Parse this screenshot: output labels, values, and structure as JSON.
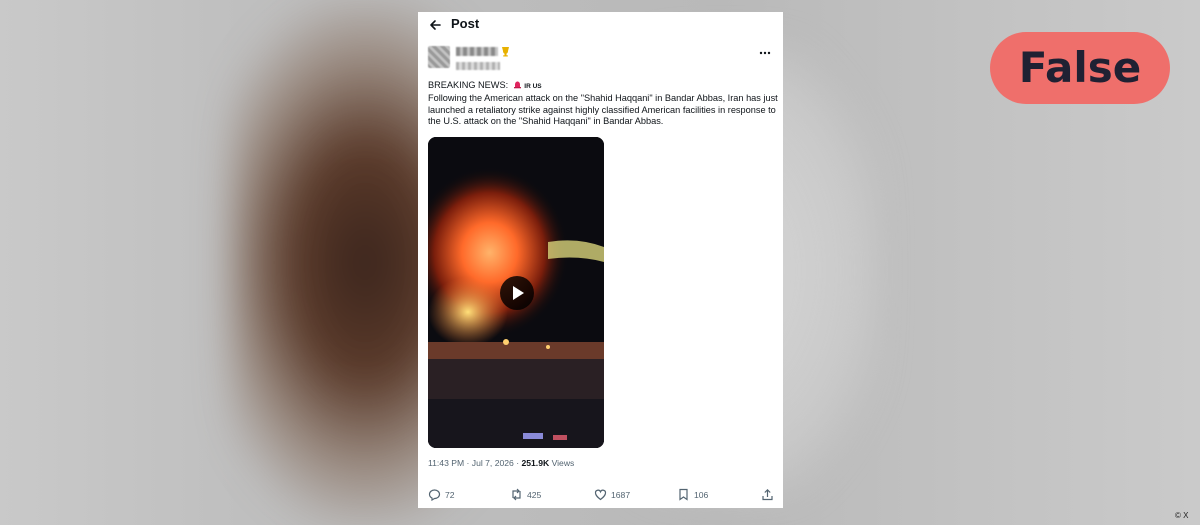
{
  "header": {
    "title": "Post"
  },
  "post": {
    "line1_prefix": "BREAKING NEWS:",
    "flag_tag": "IR US",
    "body": "Following the American attack on the \"Shahid Haqqani\" in Bandar Abbas, Iran has just launched a retaliatory strike against highly classified American facilities in response to the U.S. attack on the \"Shahid Haqqani\" in Bandar Abbas.",
    "time": "11:43 PM · Jul 7, 2026 · ",
    "views_count": "251.9K",
    "views_label": " Views"
  },
  "actions": {
    "replies": "72",
    "reposts": "425",
    "likes": "1687",
    "bookmarks": "106"
  },
  "badge": {
    "label": "False",
    "color": "#ef6f6b"
  },
  "credit": "© X",
  "icons": [
    "back-arrow-icon",
    "verified-icon",
    "more-icon",
    "alarm-icon",
    "play-icon",
    "reply-icon",
    "repost-icon",
    "like-icon",
    "bookmark-icon",
    "share-icon"
  ]
}
